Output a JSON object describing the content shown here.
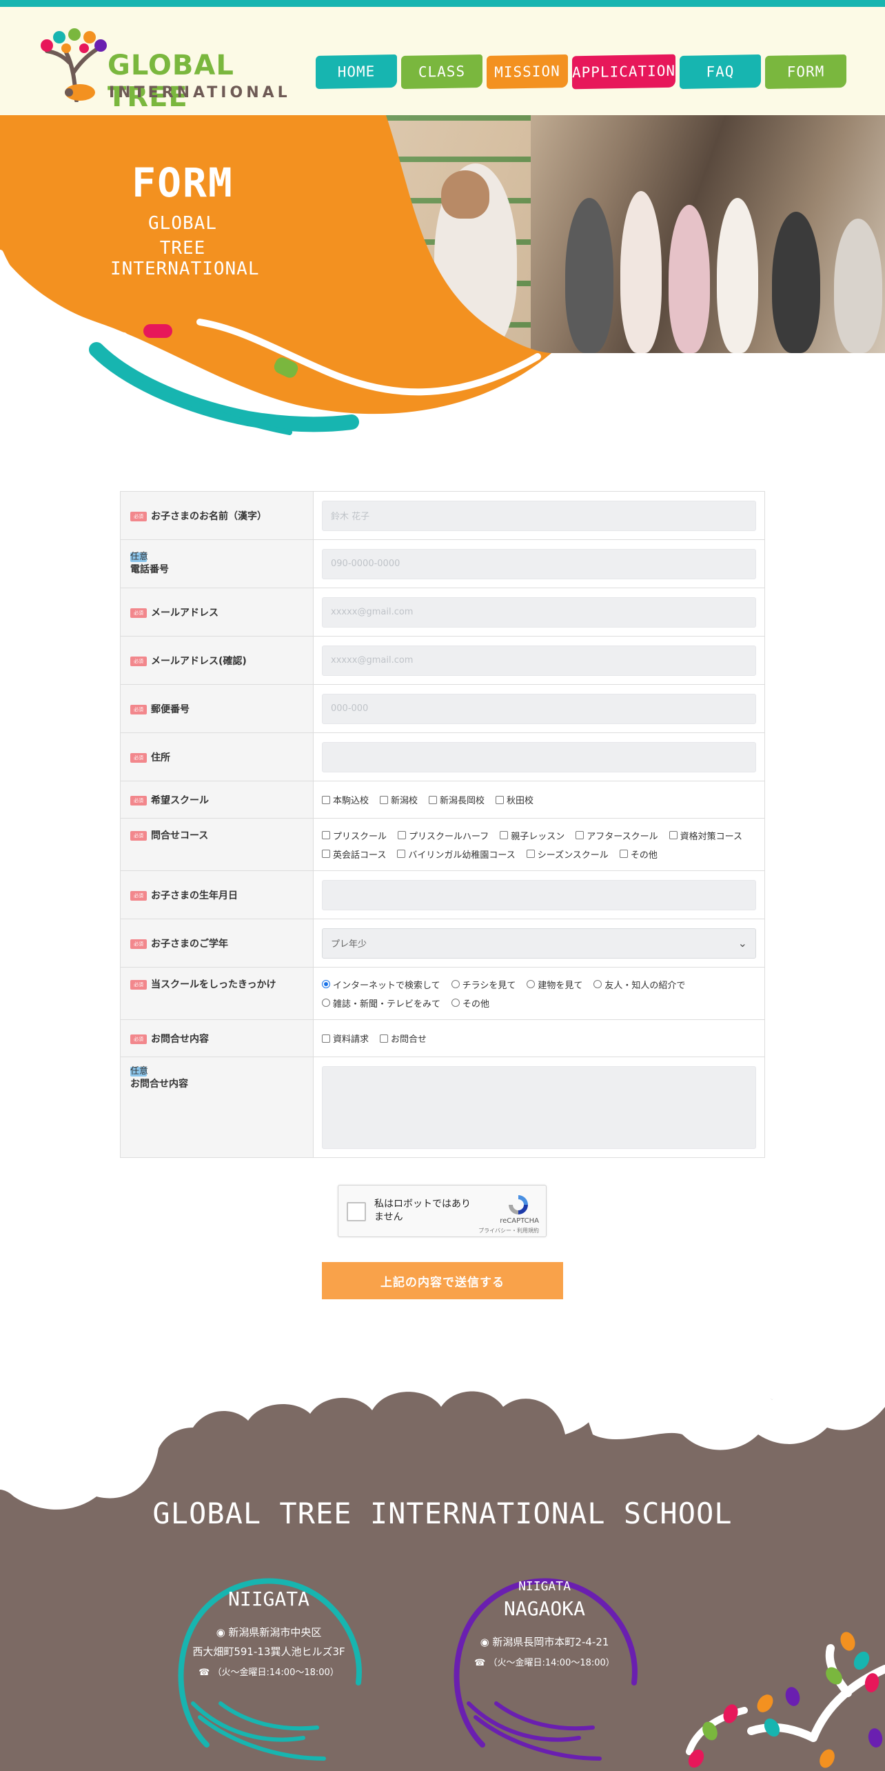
{
  "header": {
    "logo_text": "GLOBAL TREE",
    "logo_sub": "INTERNATIONAL",
    "nav": [
      {
        "label": "HOME",
        "color": "#17b5b0"
      },
      {
        "label": "CLASS",
        "color": "#7ab73e"
      },
      {
        "label": "MISSION",
        "color": "#f39120"
      },
      {
        "label": "APPLICATION",
        "color": "#e7175a"
      },
      {
        "label": "FAQ",
        "color": "#17b5b0"
      },
      {
        "label": "FORM",
        "color": "#7ab73e"
      }
    ]
  },
  "hero": {
    "title": "FORM",
    "subtitle_1": "GLOBAL",
    "subtitle_2": "TREE INTERNATIONAL"
  },
  "form": {
    "badge_required": "必須",
    "badge_optional": "任意",
    "rows": [
      {
        "label": "お子さまのお名前（漢字）",
        "required": true,
        "type": "text",
        "placeholder": "鈴木 花子"
      },
      {
        "label": "電話番号",
        "required": false,
        "type": "text",
        "placeholder": "090-0000-0000"
      },
      {
        "label": "メールアドレス",
        "required": true,
        "type": "text",
        "placeholder": "xxxxx@gmail.com"
      },
      {
        "label": "メールアドレス(確認)",
        "required": true,
        "type": "text",
        "placeholder": "xxxxx@gmail.com"
      },
      {
        "label": "郵便番号",
        "required": true,
        "type": "text",
        "placeholder": "000-000"
      },
      {
        "label": "住所",
        "required": true,
        "type": "text",
        "placeholder": ""
      },
      {
        "label": "希望スクール",
        "required": true,
        "type": "checkbox",
        "options": [
          "本駒込校",
          "新潟校",
          "新潟長岡校",
          "秋田校"
        ]
      },
      {
        "label": "問合せコース",
        "required": true,
        "type": "checkbox",
        "options": [
          "プリスクール",
          "プリスクールハーフ",
          "親子レッスン",
          "アフタースクール",
          "資格対策コース",
          "英会話コース",
          "バイリンガル幼稚園コース",
          "シーズンスクール",
          "その他"
        ]
      },
      {
        "label": "お子さまの生年月日",
        "required": true,
        "type": "text",
        "placeholder": ""
      },
      {
        "label": "お子さまのご学年",
        "required": true,
        "type": "select",
        "value": "プレ年少"
      },
      {
        "label": "当スクールをしったきっかけ",
        "required": true,
        "type": "radio",
        "options": [
          "インターネットで検索して",
          "チラシを見て",
          "建物を見て",
          "友人・知人の紹介で",
          "雑誌・新聞・テレビをみて",
          "その他"
        ],
        "selected": 0
      },
      {
        "label": "お問合せ内容",
        "required": true,
        "type": "checkbox",
        "options": [
          "資料請求",
          "お問合せ"
        ]
      },
      {
        "label": "お問合せ内容",
        "required": false,
        "type": "textarea"
      }
    ],
    "captcha_text": "私はロボットではありません",
    "captcha_brand": "reCAPTCHA",
    "captcha_links": "プライバシー・利用規約",
    "submit_label": "上記の内容で送信する"
  },
  "footer": {
    "title": "GLOBAL TREE INTERNATIONAL SCHOOL",
    "bg_color": "#7c6a64",
    "branches": [
      {
        "name": "NIIGATA",
        "address_1": "新潟県新潟市中央区",
        "address_2": "西大畑町591-13巽人池ヒルズ3F",
        "hours": "（火～金曜日:14:00～18:00）",
        "color": "#17b5b0"
      },
      {
        "region": "NIIGATA",
        "name": "NAGAOKA",
        "address_1": "新潟県長岡市本町2-4-21",
        "hours": "（火～金曜日:14:00～18:00）",
        "color": "#6a1fb0"
      }
    ]
  }
}
